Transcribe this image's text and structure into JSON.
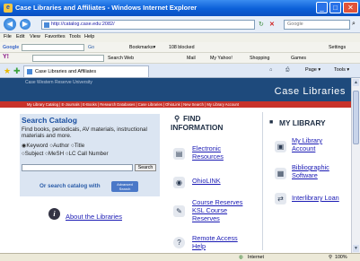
{
  "window": {
    "title": "Case Libraries and Affiliates - Windows Internet Explorer",
    "minimize": "_",
    "maximize": "□",
    "close": "✕"
  },
  "address_bar": {
    "back": "◀",
    "forward": "▶",
    "url": "http://catalog.case.edu:2082/",
    "search_placeholder": "Google"
  },
  "menu": [
    "File",
    "Edit",
    "View",
    "Favorites",
    "Tools",
    "Help"
  ],
  "google_toolbar": {
    "label": "Google",
    "go": "Go",
    "items": [
      "Bookmarks▾",
      "108 blocked"
    ],
    "settings": "Settings"
  },
  "yahoo_toolbar": {
    "label": "Y!",
    "search_web": "Search Web",
    "items": [
      "Mail",
      "My Yahoo!",
      "Shopping",
      "Games"
    ]
  },
  "tab": {
    "label": "Case Libraries and Affiliates",
    "tools": [
      "Page ▾",
      "Tools ▾"
    ]
  },
  "banner": {
    "site_name": "Case Libraries",
    "top_links": "Case Western Reserve University",
    "links_bar": "My Library Catalog | E-Journals | E-Books | Research Databases | Case Libraries | OhioLink | New Search | My Library Account"
  },
  "search_catalog": {
    "heading": "Search Catalog",
    "description": "Find books, periodicals, AV materials, instructional materials and more.",
    "option_row1": [
      "Keyword",
      "Author",
      "Title"
    ],
    "option_row2": [
      "Subject",
      "MeSH",
      "LC Call Number"
    ],
    "search_button": "Search",
    "or_text": "Or search catalog with",
    "advanced_label": "Advanced Search"
  },
  "about": {
    "label": "About the Libraries"
  },
  "find_information": {
    "heading_line1": "FIND",
    "heading_line2": "INFORMATION",
    "electronic_resources": [
      "Electronic",
      "Resources"
    ],
    "ohiolink": "OhioLINK",
    "course_reserves": [
      "Course Reserves",
      "KSL Course",
      "Reserves"
    ],
    "remote_access": [
      "Remote Access",
      "Help"
    ]
  },
  "my_library": {
    "heading": "MY LIBRARY",
    "account": [
      "My Library",
      "Account"
    ],
    "bibliographic": [
      "Bibliographic",
      "Software"
    ],
    "interlibrary": "Interlibrary Loan"
  },
  "status_bar": {
    "zone": "Internet",
    "zoom": "100%"
  }
}
